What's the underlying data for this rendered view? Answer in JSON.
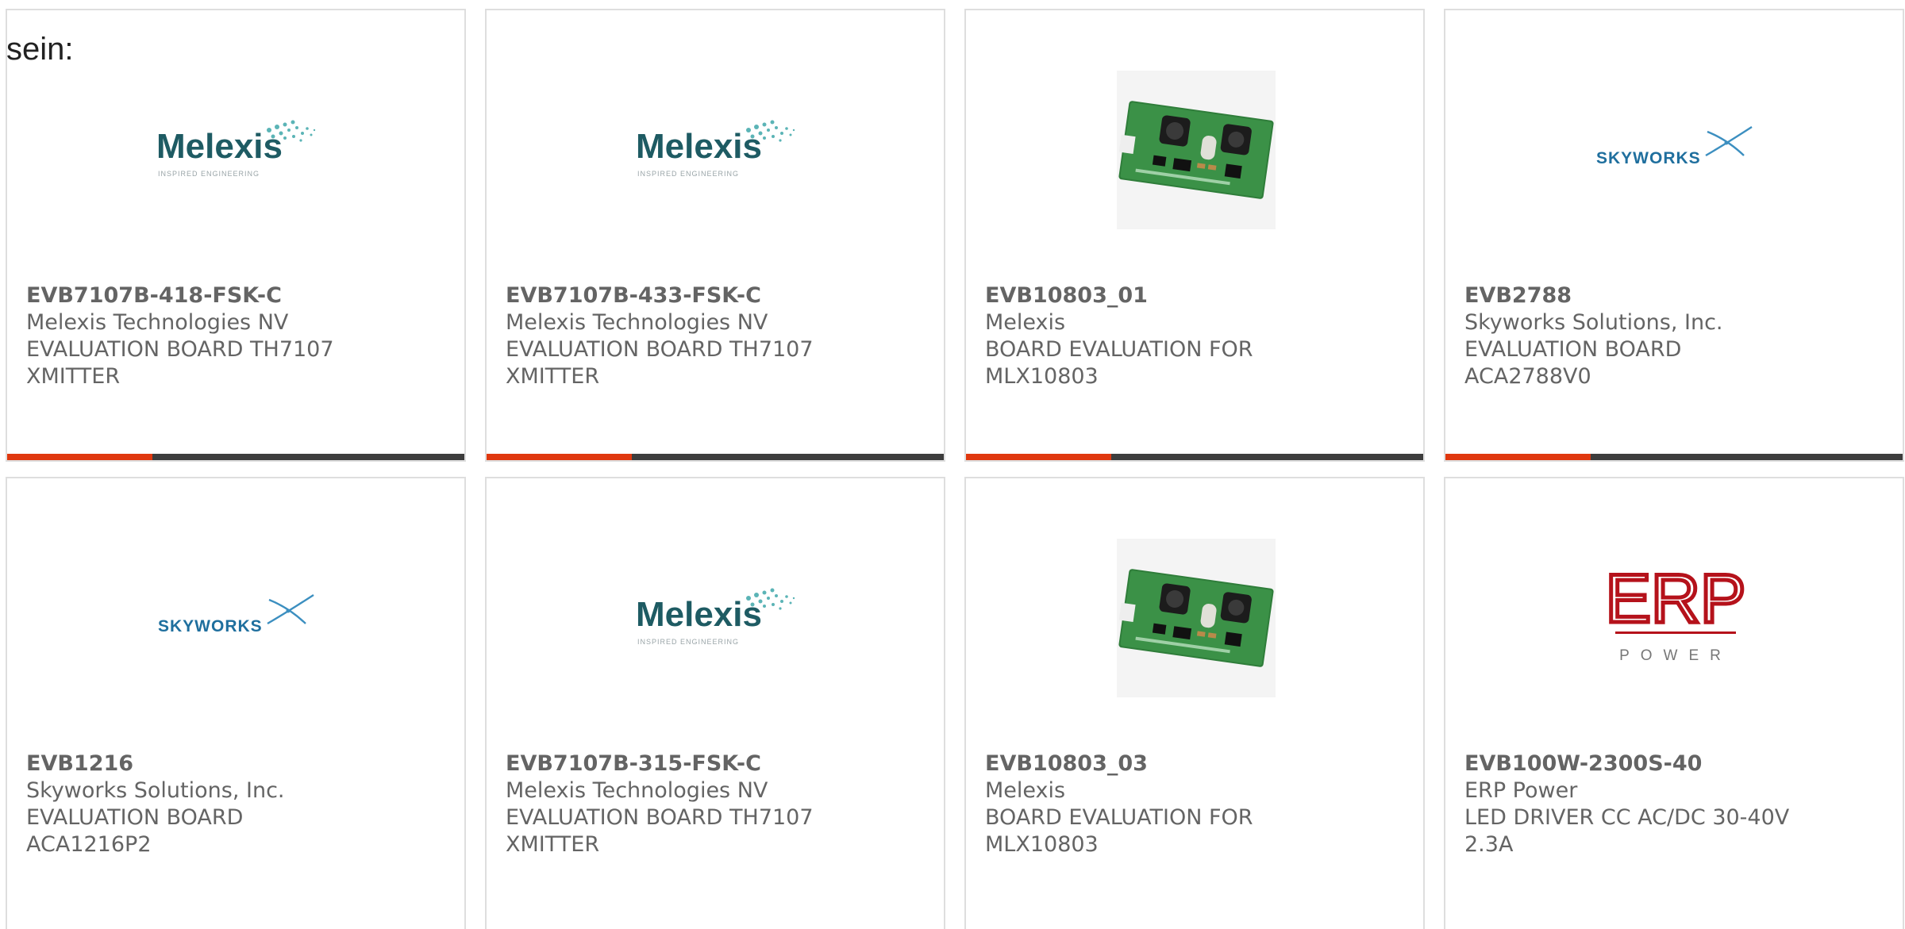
{
  "intro_text": "sein:",
  "products": [
    {
      "part_number": "EVB7107B-418-FSK-C",
      "manufacturer": "Melexis Technologies NV",
      "desc_line1": "EVALUATION BOARD TH7107",
      "desc_line2": "XMITTER",
      "image": "melexis-logo"
    },
    {
      "part_number": "EVB7107B-433-FSK-C",
      "manufacturer": "Melexis Technologies NV",
      "desc_line1": "EVALUATION BOARD TH7107",
      "desc_line2": "XMITTER",
      "image": "melexis-logo"
    },
    {
      "part_number": "EVB10803_01",
      "manufacturer": "Melexis",
      "desc_line1": "BOARD EVALUATION FOR",
      "desc_line2": "MLX10803",
      "image": "pcb-photo"
    },
    {
      "part_number": "EVB2788",
      "manufacturer": "Skyworks Solutions, Inc.",
      "desc_line1": "EVALUATION BOARD ACA2788V0",
      "desc_line2": "",
      "image": "skyworks-logo"
    },
    {
      "part_number": "EVB1216",
      "manufacturer": "Skyworks Solutions, Inc.",
      "desc_line1": "EVALUATION BOARD ACA1216P2",
      "desc_line2": "",
      "image": "skyworks-logo"
    },
    {
      "part_number": "EVB7107B-315-FSK-C",
      "manufacturer": "Melexis Technologies NV",
      "desc_line1": "EVALUATION BOARD TH7107",
      "desc_line2": "XMITTER",
      "image": "melexis-logo"
    },
    {
      "part_number": "EVB10803_03",
      "manufacturer": "Melexis",
      "desc_line1": "BOARD EVALUATION FOR",
      "desc_line2": "MLX10803",
      "image": "pcb-photo"
    },
    {
      "part_number": "EVB100W-2300S-40",
      "manufacturer": "ERP Power",
      "desc_line1": "LED DRIVER CC AC/DC 30-40V",
      "desc_line2": "2.3A",
      "image": "erp-power-logo"
    }
  ],
  "logos": {
    "melexis": {
      "name": "Melexis",
      "tagline": "INSPIRED ENGINEERING"
    },
    "skyworks": {
      "name": "SKYWORKS"
    },
    "erp": {
      "name": "ERP",
      "sub": "POWER"
    }
  },
  "colors": {
    "accent": "#e0380f",
    "bar": "#3d3d3d",
    "border": "#dedede",
    "text": "#646464",
    "melexis_teal": "#1e5b63",
    "skyworks_blue": "#1f6f9e",
    "erp_red": "#b5121b"
  }
}
